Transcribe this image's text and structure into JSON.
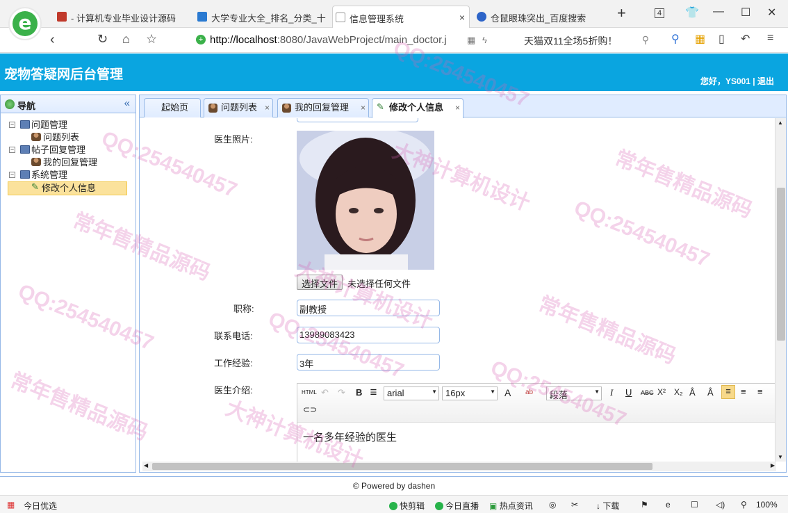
{
  "browser": {
    "tabs": [
      {
        "label": "- 计算机专业毕业设计源码",
        "active": false,
        "color": "#c0392b"
      },
      {
        "label": "大学专业大全_排名_分类_十",
        "active": false,
        "color": "#2a7ad1"
      },
      {
        "label": "信息管理系统",
        "active": true,
        "color": "#999999"
      },
      {
        "label": "仓鼠眼珠突出_百度搜索",
        "active": false,
        "color": "#2d64c8"
      }
    ],
    "new_tab": "+",
    "tab_count": "4",
    "url_host": "http://localhost",
    "url_rest": ":8080/JavaWebProject/main_doctor.j",
    "search_text": "天猫双11全场5折购！"
  },
  "app": {
    "title": "宠物答疑网后台管理",
    "user_line": "您好，YS001 | 退出"
  },
  "nav": {
    "title": "导航",
    "collapse": "«",
    "groups": [
      {
        "label": "问题管理",
        "children": [
          "问题列表"
        ]
      },
      {
        "label": "帖子回复管理",
        "children": [
          "我的回复管理"
        ]
      },
      {
        "label": "系统管理",
        "children": [
          "修改个人信息"
        ]
      }
    ]
  },
  "tabs": [
    {
      "label": "起始页",
      "closable": false
    },
    {
      "label": "问题列表",
      "closable": true
    },
    {
      "label": "我的回复管理",
      "closable": true
    },
    {
      "label": "修改个人信息",
      "closable": true,
      "active": true
    }
  ],
  "close_glyph": "×",
  "form": {
    "photo_label": "医生照片:",
    "file_button": "选择文件",
    "file_status": "未选择任何文件",
    "title_label": "职称:",
    "title_value": "副教授",
    "phone_label": "联系电话:",
    "phone_value": "13989083423",
    "experience_label": "工作经验:",
    "experience_value": "3年",
    "intro_label": "医生介绍:",
    "intro_text": "一名多年经验的医生"
  },
  "editor": {
    "html_btn": "HTML",
    "font_family": "arial",
    "font_size": "16px",
    "paragraph": "段落",
    "bold": "B",
    "italic": "I",
    "underline": "U",
    "strike": "ABC",
    "sup": "X²",
    "sub": "X₂",
    "font_color": "A",
    "bg_color": "ab"
  },
  "footer": "© Powered by dashen",
  "statusbar": {
    "left": "今日优选",
    "items": [
      "快剪辑",
      "今日直播",
      "热点资讯",
      "下载"
    ],
    "zoom": "100%"
  },
  "watermarks": [
    "QQ:254540457",
    "常年售精品源码",
    "大神计算机设计"
  ]
}
